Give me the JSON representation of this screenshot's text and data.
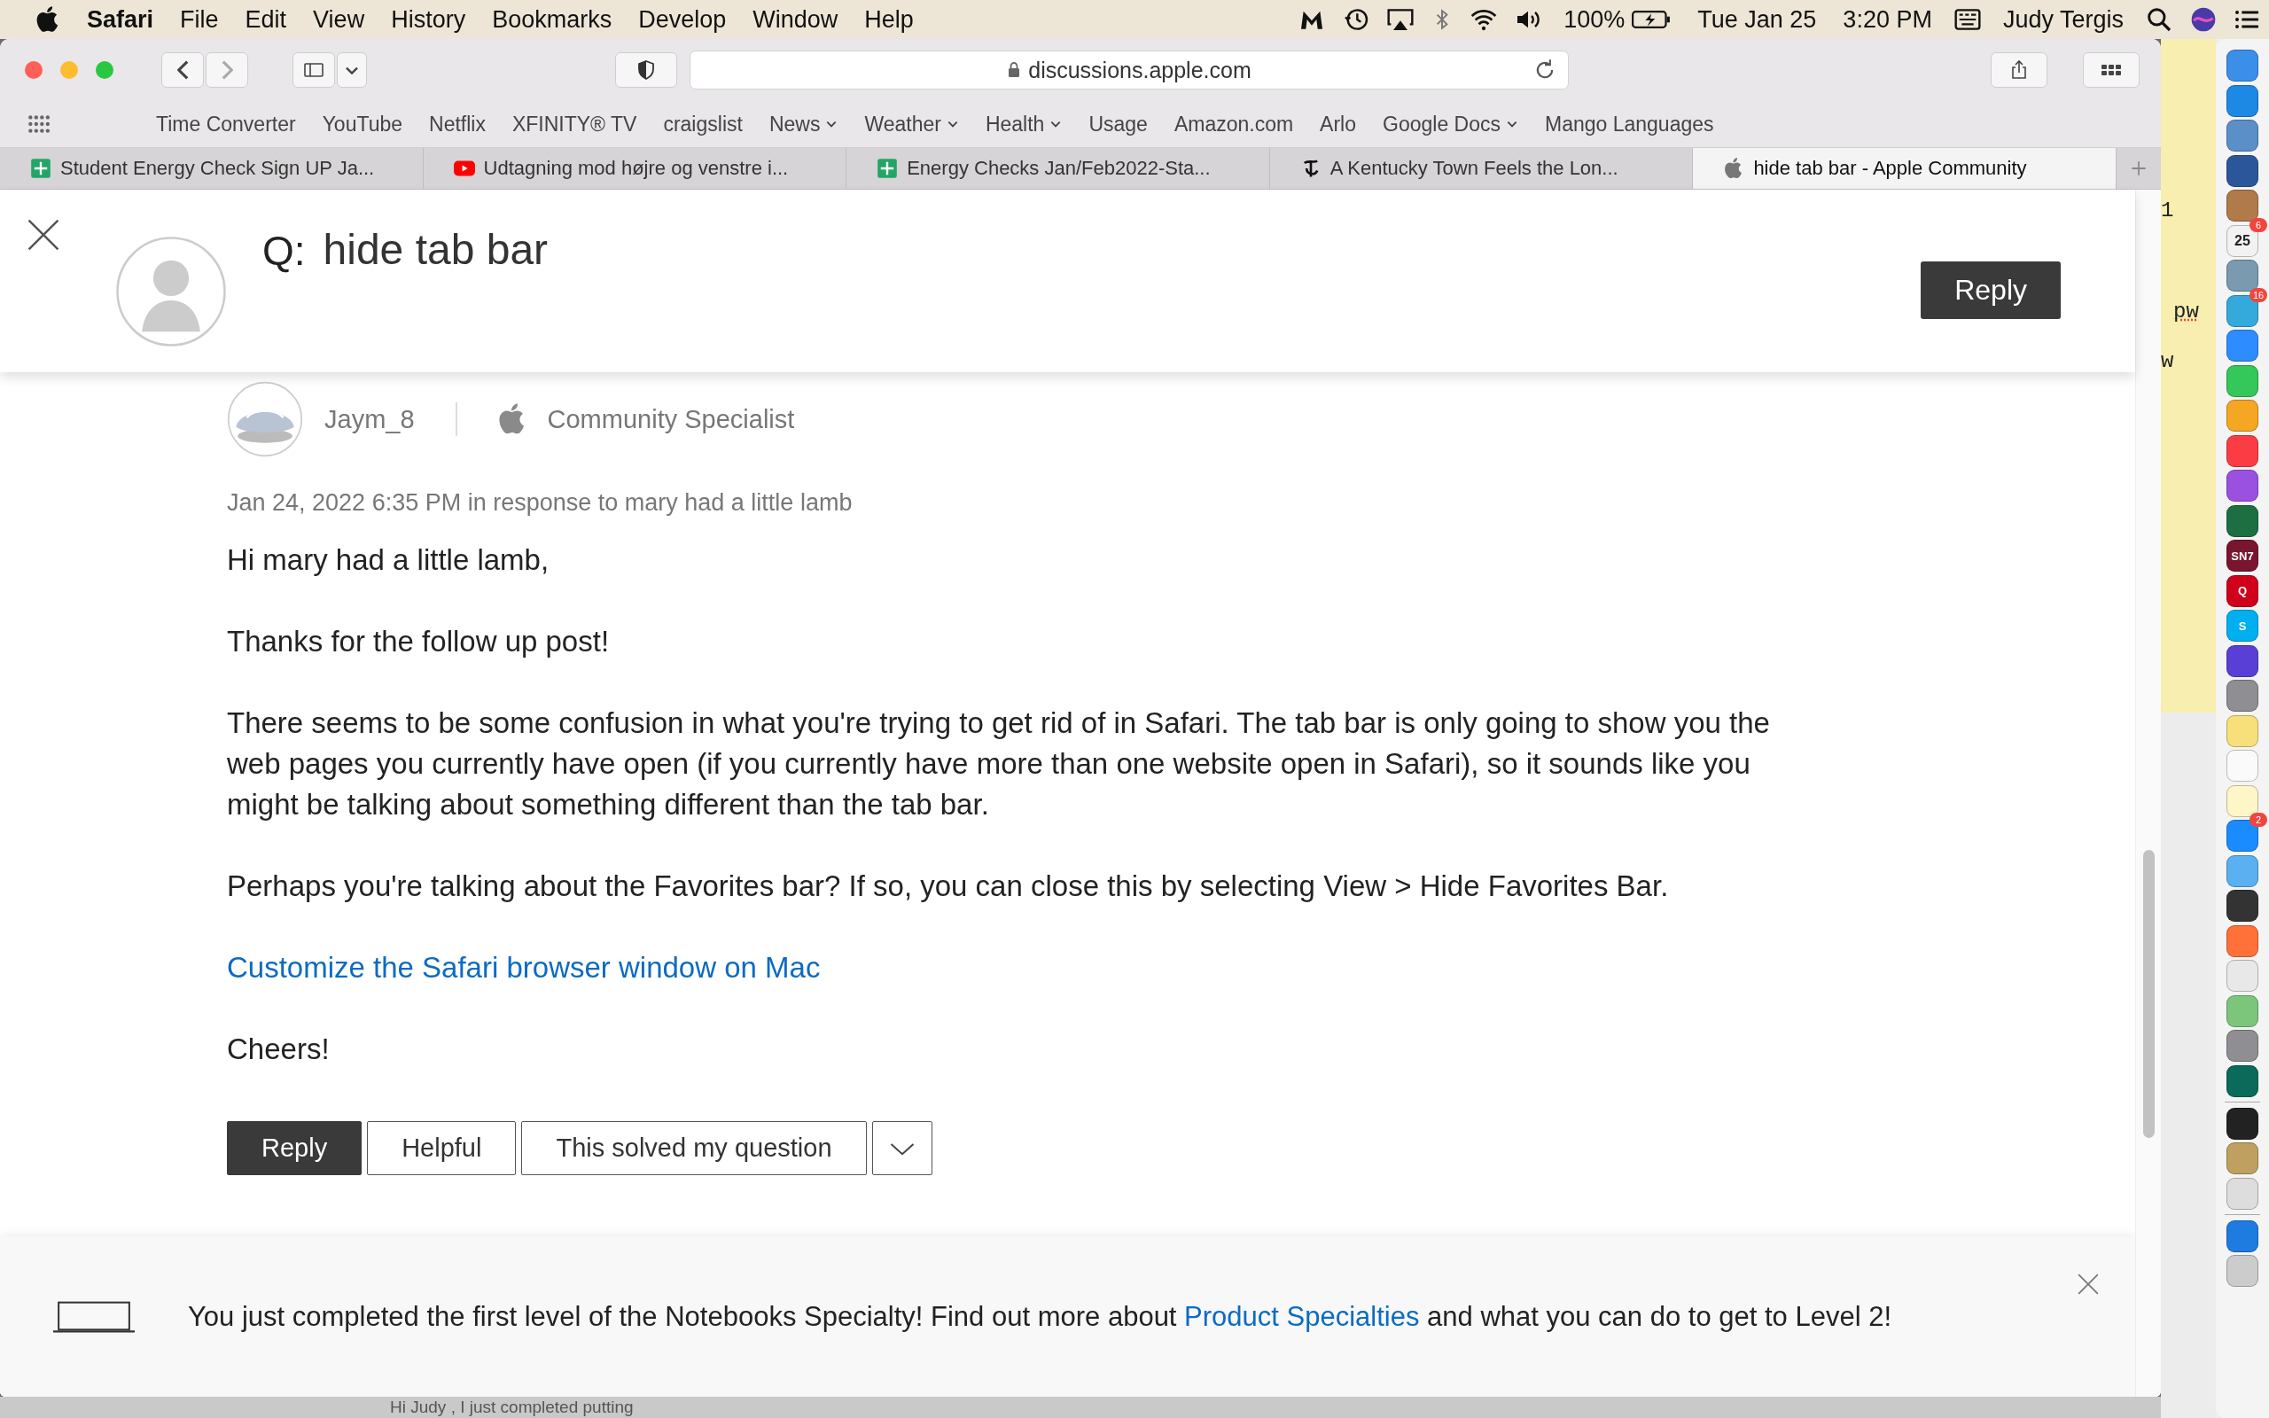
{
  "menubar": {
    "app": "Safari",
    "items": [
      "File",
      "Edit",
      "View",
      "History",
      "Bookmarks",
      "Develop",
      "Window",
      "Help"
    ],
    "battery": "100%",
    "date": "Tue Jan 25",
    "time": "3:20 PM",
    "user": "Judy Tergis"
  },
  "toolbar": {
    "url": "discussions.apple.com"
  },
  "bookmarks": [
    {
      "label": "Time Converter",
      "menu": false
    },
    {
      "label": "YouTube",
      "menu": false
    },
    {
      "label": "Netflix",
      "menu": false
    },
    {
      "label": "XFINITY® TV",
      "menu": false
    },
    {
      "label": "craigslist",
      "menu": false
    },
    {
      "label": "News",
      "menu": true
    },
    {
      "label": "Weather",
      "menu": true
    },
    {
      "label": "Health",
      "menu": true
    },
    {
      "label": "Usage",
      "menu": false
    },
    {
      "label": "Amazon.com",
      "menu": false
    },
    {
      "label": "Arlo",
      "menu": false
    },
    {
      "label": "Google Docs",
      "menu": true
    },
    {
      "label": "Mango Languages",
      "menu": false
    }
  ],
  "tabs": [
    {
      "title": "Student Energy Check Sign UP Ja...",
      "kind": "sheet",
      "selected": false
    },
    {
      "title": "Udtagning mod højre og venstre i...",
      "kind": "video",
      "selected": false
    },
    {
      "title": "Energy Checks Jan/Feb2022-Sta...",
      "kind": "sheet",
      "selected": false
    },
    {
      "title": "A Kentucky Town Feels the Lon...",
      "kind": "news",
      "selected": false
    },
    {
      "title": "hide tab bar - Apple Community",
      "kind": "apple",
      "selected": true
    }
  ],
  "question": {
    "prefix": "Q:",
    "title": "hide tab bar",
    "reply": "Reply"
  },
  "post": {
    "author": "Jaym_8",
    "role": "Community Specialist",
    "meta": "Jan 24, 2022 6:35 PM in response to mary had a little lamb",
    "paragraphs": [
      {
        "kind": "text",
        "text": "Hi mary had a little lamb,"
      },
      {
        "kind": "text",
        "text": "Thanks for the follow up post!"
      },
      {
        "kind": "text",
        "text": "There seems to be some confusion in what you're trying to get rid of in Safari. The tab bar is only going to show you the web pages you currently have open (if you currently have more than one website open in Safari), so it sounds like you might be talking about something different than the tab bar."
      },
      {
        "kind": "text",
        "text": "Perhaps you're talking about the Favorites bar? If so, you can close this by selecting View > Hide Favorites Bar."
      },
      {
        "kind": "link",
        "text": "Customize the Safari browser window on Mac"
      },
      {
        "kind": "text",
        "text": "Cheers!"
      }
    ],
    "actions": [
      {
        "label": "Reply",
        "primary": true
      },
      {
        "label": "Helpful",
        "primary": false
      },
      {
        "label": "This solved my question",
        "primary": false
      }
    ]
  },
  "banner": {
    "before": "You just completed the first level of the Notebooks Specialty! Find out more about ",
    "link": "Product Specialties",
    "after": " and what you can do to get to Level 2!"
  },
  "desktop": {
    "snippet": "Hi Judy , I just completed putting"
  },
  "sticky_note": {
    "texts": [
      "1",
      "pw",
      "w"
    ]
  },
  "dock": [
    {
      "kind": "app",
      "color": "#3b8fe8"
    },
    {
      "kind": "app",
      "color": "#1e88e5"
    },
    {
      "kind": "app",
      "color": "#5a8fc8"
    },
    {
      "kind": "app",
      "color": "#2b579a"
    },
    {
      "kind": "app",
      "color": "#b07a4a"
    },
    {
      "kind": "app",
      "color": "#f2f2f2",
      "label": "25",
      "badge": "6"
    },
    {
      "kind": "app",
      "color": "#7a9ab0"
    },
    {
      "kind": "app",
      "color": "#34aadc",
      "badge": "16"
    },
    {
      "kind": "app",
      "color": "#2d8cff"
    },
    {
      "kind": "app",
      "color": "#34c759"
    },
    {
      "kind": "app",
      "color": "#f5a623"
    },
    {
      "kind": "app",
      "color": "#fc3c44"
    },
    {
      "kind": "app",
      "color": "#9b51e0"
    },
    {
      "kind": "app",
      "color": "#1d6f42"
    },
    {
      "kind": "app",
      "color": "#7a1530",
      "label": "SN7"
    },
    {
      "kind": "app",
      "color": "#d0021b",
      "label": "Q"
    },
    {
      "kind": "app",
      "color": "#00aff0",
      "label": "S"
    },
    {
      "kind": "app",
      "color": "#5a3fd6"
    },
    {
      "kind": "app",
      "color": "#8e8e93"
    },
    {
      "kind": "app",
      "color": "#f7e07a"
    },
    {
      "kind": "app",
      "color": "#fafafa"
    },
    {
      "kind": "app",
      "color": "#fff6c8"
    },
    {
      "kind": "app",
      "color": "#1a8cff",
      "badge": "2"
    },
    {
      "kind": "app",
      "color": "#5ab0f0"
    },
    {
      "kind": "app",
      "color": "#333333"
    },
    {
      "kind": "app",
      "color": "#ff7139"
    },
    {
      "kind": "app",
      "color": "#e8e8e8"
    },
    {
      "kind": "app",
      "color": "#7cc67c"
    },
    {
      "kind": "app",
      "color": "#8e8e93"
    },
    {
      "kind": "app",
      "color": "#0a6b5a"
    },
    {
      "kind": "separator"
    },
    {
      "kind": "app",
      "color": "#222222"
    },
    {
      "kind": "app",
      "color": "#c0a060"
    },
    {
      "kind": "app",
      "color": "#dddddd"
    },
    {
      "kind": "separator"
    },
    {
      "kind": "app",
      "color": "#1e7be0"
    },
    {
      "kind": "app",
      "color": "#cccccc"
    }
  ]
}
